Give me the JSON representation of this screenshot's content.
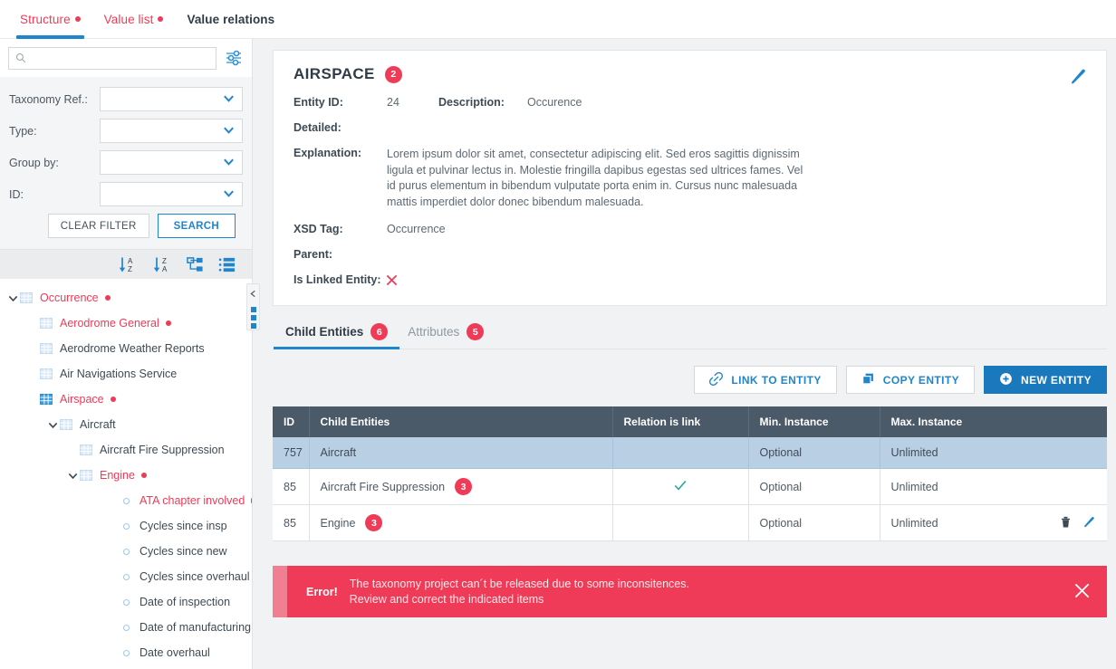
{
  "top_tabs": [
    {
      "label": "Structure",
      "dot": true,
      "style": "red",
      "active": true
    },
    {
      "label": "Value list",
      "dot": true,
      "style": "red",
      "active": false
    },
    {
      "label": "Value relations",
      "dot": false,
      "style": "dark",
      "active": false
    }
  ],
  "search": {
    "value": "",
    "placeholder": ""
  },
  "filters": {
    "fields": [
      {
        "label": "Taxonomy Ref.:",
        "value": ""
      },
      {
        "label": "Type:",
        "value": ""
      },
      {
        "label": "Group by:",
        "value": ""
      },
      {
        "label": "ID:",
        "value": ""
      }
    ],
    "clear_label": "CLEAR FILTER",
    "search_label": "SEARCH"
  },
  "sort_tools": [
    {
      "name": "sort-az-icon"
    },
    {
      "name": "sort-za-icon"
    },
    {
      "name": "tree-view-icon"
    },
    {
      "name": "list-view-icon"
    }
  ],
  "tree": [
    {
      "label": "Occurrence",
      "indent": 0,
      "twist": "down",
      "icon": "table",
      "red": true,
      "dot": true
    },
    {
      "label": "Aerodrome General",
      "indent": 1,
      "twist": "",
      "icon": "table",
      "red": true,
      "dot": true
    },
    {
      "label": "Aerodrome Weather Reports",
      "indent": 1,
      "twist": "",
      "icon": "table",
      "red": false,
      "dot": false
    },
    {
      "label": "Air Navigations Service",
      "indent": 1,
      "twist": "",
      "icon": "table",
      "red": false,
      "dot": false
    },
    {
      "label": "Airspace",
      "indent": 1,
      "twist": "",
      "icon": "table-active",
      "red": true,
      "dot": true
    },
    {
      "label": "Aircraft",
      "indent": 2,
      "twist": "down",
      "icon": "table",
      "red": false,
      "dot": false
    },
    {
      "label": "Aircraft Fire Suppression",
      "indent": 3,
      "twist": "",
      "icon": "table",
      "red": false,
      "dot": false
    },
    {
      "label": "Engine",
      "indent": 3,
      "twist": "down",
      "icon": "table",
      "red": true,
      "dot": true
    },
    {
      "label": "ATA chapter involved",
      "indent": 5,
      "twist": "",
      "icon": "ring",
      "red": true,
      "dot": true
    },
    {
      "label": "Cycles since insp",
      "indent": 5,
      "twist": "",
      "icon": "ring",
      "red": false,
      "dot": false
    },
    {
      "label": "Cycles since new",
      "indent": 5,
      "twist": "",
      "icon": "ring",
      "red": false,
      "dot": false
    },
    {
      "label": "Cycles since overhaul",
      "indent": 5,
      "twist": "",
      "icon": "ring",
      "red": false,
      "dot": false
    },
    {
      "label": "Date of inspection",
      "indent": 5,
      "twist": "",
      "icon": "ring",
      "red": false,
      "dot": false
    },
    {
      "label": "Date of manufacturing",
      "indent": 5,
      "twist": "",
      "icon": "ring",
      "red": false,
      "dot": false
    },
    {
      "label": "Date overhaul",
      "indent": 5,
      "twist": "",
      "icon": "ring",
      "red": false,
      "dot": false
    }
  ],
  "detail": {
    "title": "AIRSPACE",
    "title_badge": "2",
    "entity_id_label": "Entity ID:",
    "entity_id_value": "24",
    "description_label": "Description:",
    "description_value": "Occurence",
    "detailed_label": "Detailed:",
    "detailed_value": "",
    "explanation_label": "Explanation:",
    "explanation_value": "Lorem ipsum dolor sit amet, consectetur adipiscing elit. Sed eros sagittis dignissim ligula et pulvinar lectus in. Molestie fringilla dapibus egestas sed ultrices fames. Vel id purus elementum in bibendum vulputate porta enim in. Cursus nunc malesuada mattis imperdiet dolor donec bibendum malesuada.",
    "xsd_tag_label": "XSD Tag:",
    "xsd_tag_value": "Occurrence",
    "parent_label": "Parent:",
    "parent_value": "",
    "is_linked_label": "Is Linked Entity:",
    "is_linked_value": false
  },
  "sub_tabs": [
    {
      "label": "Child Entities",
      "badge": "6",
      "active": true
    },
    {
      "label": "Attributes",
      "badge": "5",
      "active": false
    }
  ],
  "actions": [
    {
      "label": "LINK TO ENTITY",
      "icon": "link-icon",
      "style": "ghost"
    },
    {
      "label": "COPY ENTITY",
      "icon": "copy-icon",
      "style": "ghost"
    },
    {
      "label": "NEW ENTITY",
      "icon": "plus-circle-icon",
      "style": "solid"
    }
  ],
  "table": {
    "columns": [
      "ID",
      "Child Entities",
      "Relation is link",
      "Min. Instance",
      "Max. Instance"
    ],
    "rows": [
      {
        "id": "757",
        "name": "Aircraft",
        "badge": "",
        "relation_is_link": false,
        "min": "Optional",
        "max": "Unlimited",
        "selected": true,
        "row_icons": false
      },
      {
        "id": "85",
        "name": "Aircraft Fire Suppression",
        "badge": "3",
        "relation_is_link": true,
        "min": "Optional",
        "max": "Unlimited",
        "selected": false,
        "row_icons": false
      },
      {
        "id": "85",
        "name": "Engine",
        "badge": "3",
        "relation_is_link": false,
        "min": "Optional",
        "max": "Unlimited",
        "selected": false,
        "row_icons": true
      }
    ]
  },
  "error": {
    "title": "Error!",
    "line1": "The taxonomy project can´t be released due to some inconsitences.",
    "line2": "Review and correct the indicated items"
  },
  "colors": {
    "accent_blue": "#1f86cd",
    "accent_red": "#ef3b57",
    "table_header": "#4a5a68",
    "row_selected": "#b9cfe4",
    "check_green": "#2aa9a0"
  }
}
